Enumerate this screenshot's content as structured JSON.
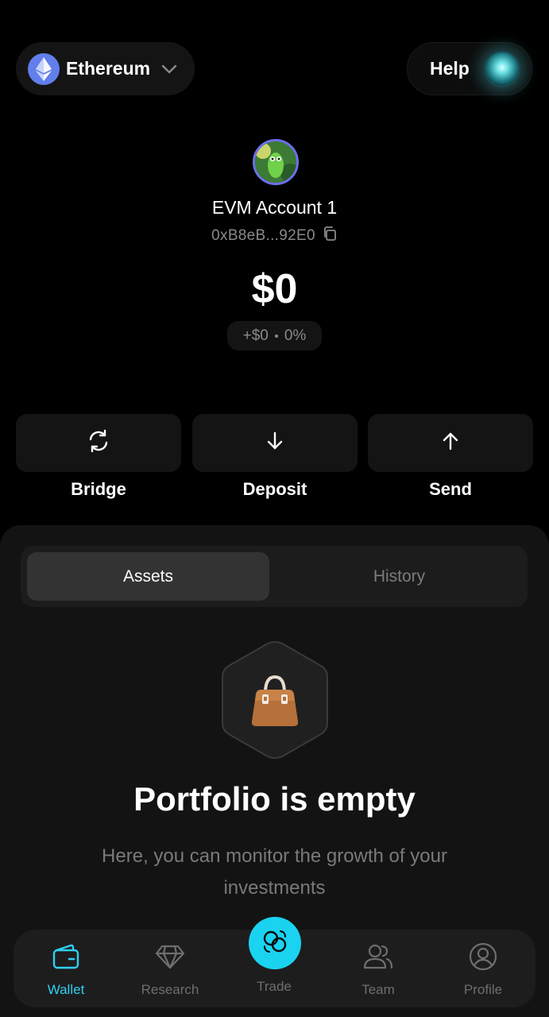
{
  "header": {
    "network": "Ethereum",
    "help_label": "Help"
  },
  "account": {
    "name": "EVM Account 1",
    "address": "0xB8eB...92E0",
    "balance": "$0",
    "change_amount": "+$0",
    "change_percent": "0%"
  },
  "actions": [
    {
      "label": "Bridge",
      "icon": "refresh-icon"
    },
    {
      "label": "Deposit",
      "icon": "arrow-down-icon"
    },
    {
      "label": "Send",
      "icon": "arrow-up-icon"
    }
  ],
  "tabs": {
    "assets": "Assets",
    "history": "History",
    "active": "Assets"
  },
  "empty_state": {
    "title": "Portfolio is empty",
    "description": "Here, you can monitor the growth of your investments"
  },
  "nav": {
    "wallet": "Wallet",
    "research": "Research",
    "trade": "Trade",
    "team": "Team",
    "profile": "Profile",
    "active": "Wallet"
  },
  "colors": {
    "accent": "#19d3f0",
    "background": "#000000",
    "ethereum": "#627eea"
  }
}
